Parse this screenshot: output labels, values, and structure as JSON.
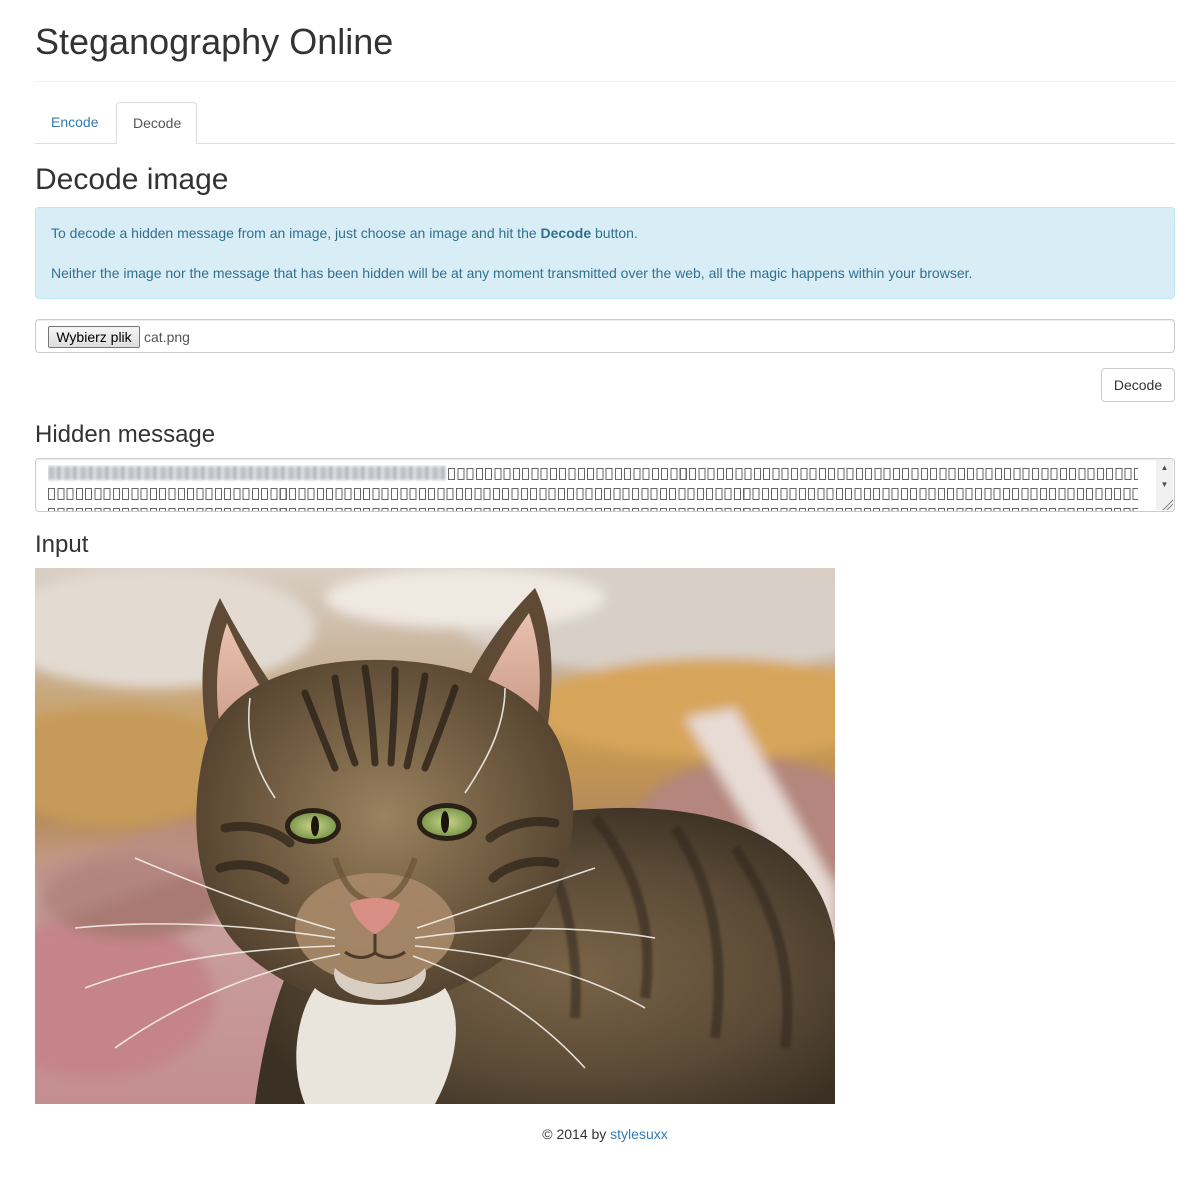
{
  "header": {
    "title": "Steganography Online"
  },
  "tabs": [
    {
      "label": "Encode",
      "active": false
    },
    {
      "label": "Decode",
      "active": true
    }
  ],
  "decode": {
    "title": "Decode image",
    "info": {
      "line1_before": "To decode a hidden message from an image, just choose an image and hit the ",
      "line1_bold": "Decode",
      "line1_after": " button.",
      "line2": "Neither the image nor the message that has been hidden will be at any moment transmitted over the web, all the magic happens within your browser."
    },
    "file_input": {
      "button_label": "Wybierz plik",
      "file_name": "cat.png"
    },
    "decode_button_label": "Decode"
  },
  "hidden_message": {
    "title": "Hidden message"
  },
  "input_section": {
    "title": "Input",
    "image_alt": "tabby cat"
  },
  "footer": {
    "text": "© 2014 by ",
    "link_label": "stylesuxx"
  },
  "colors": {
    "link": "#337ab7",
    "alert_bg": "#d9edf7",
    "alert_border": "#bce8f1",
    "alert_text": "#31708f"
  }
}
